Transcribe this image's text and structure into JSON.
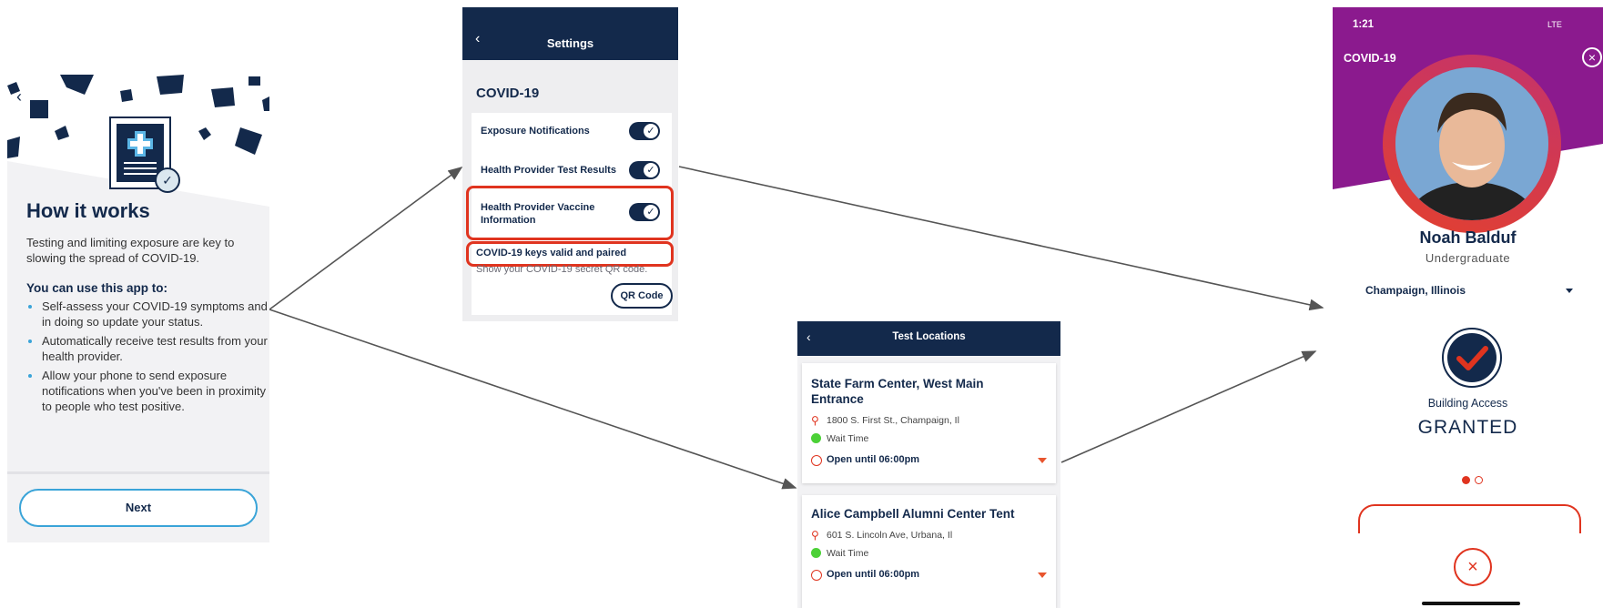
{
  "how_it_works": {
    "back_icon": "chevron-left-icon",
    "title": "How it works",
    "intro": "Testing and limiting exposure are key to slowing the spread of COVID-19.",
    "subheading": "You can use this app to:",
    "bullets": [
      "Self-assess your COVID-19 symptoms and in doing so update your status.",
      "Automatically receive test results from your health provider.",
      "Allow your phone to send exposure notifications when you've been in proximity to people who test positive."
    ],
    "next_button": "Next"
  },
  "settings": {
    "header_title": "Settings",
    "section": "COVID-19",
    "rows": [
      {
        "label": "Exposure Notifications",
        "enabled": true
      },
      {
        "label": "Health Provider Test Results",
        "enabled": true
      },
      {
        "label": "Health Provider Vaccine Information",
        "enabled": true
      }
    ],
    "keys_status": "COVID-19 keys valid and paired",
    "qr_text": "Show your COVID-19 secret QR code.",
    "qr_button": "QR Code",
    "highlight_color": "#e0341f"
  },
  "test_locations": {
    "header_title": "Test Locations",
    "locations": [
      {
        "name": "State Farm Center, West Main Entrance",
        "address": "1800 S. First St., Champaign, Il",
        "wait": "Wait Time",
        "hours": "Open until 06:00pm"
      },
      {
        "name": "Alice Campbell Alumni Center Tent",
        "address": "601 S. Lincoln Ave, Urbana, Il",
        "wait": "Wait Time",
        "hours": "Open until 06:00pm"
      }
    ]
  },
  "building_access": {
    "status_time": "1:21",
    "status_right": "LTE",
    "app_title": "COVID-19",
    "user_name": "Noah Balduf",
    "user_role": "Undergraduate",
    "location": "Champaign, Illinois",
    "access_label": "Building Access",
    "access_status": "GRANTED"
  },
  "colors": {
    "navy": "#13294b",
    "accent_orange": "#e8552e",
    "accent_red": "#e0341f",
    "purple": "#8b1a8e",
    "light_blue": "#3aa4d8",
    "green": "#4cd137"
  }
}
